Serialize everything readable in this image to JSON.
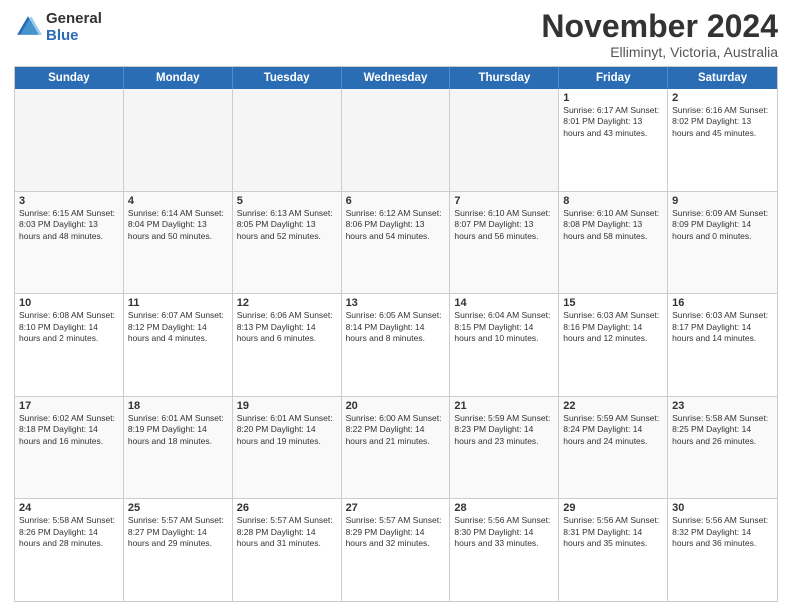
{
  "logo": {
    "line1": "General",
    "line2": "Blue"
  },
  "title": "November 2024",
  "subtitle": "Elliminyt, Victoria, Australia",
  "header_days": [
    "Sunday",
    "Monday",
    "Tuesday",
    "Wednesday",
    "Thursday",
    "Friday",
    "Saturday"
  ],
  "rows": [
    [
      {
        "day": "",
        "text": "",
        "empty": true
      },
      {
        "day": "",
        "text": "",
        "empty": true
      },
      {
        "day": "",
        "text": "",
        "empty": true
      },
      {
        "day": "",
        "text": "",
        "empty": true
      },
      {
        "day": "",
        "text": "",
        "empty": true
      },
      {
        "day": "1",
        "text": "Sunrise: 6:17 AM\nSunset: 8:01 PM\nDaylight: 13 hours\nand 43 minutes.",
        "empty": false
      },
      {
        "day": "2",
        "text": "Sunrise: 6:16 AM\nSunset: 8:02 PM\nDaylight: 13 hours\nand 45 minutes.",
        "empty": false
      }
    ],
    [
      {
        "day": "3",
        "text": "Sunrise: 6:15 AM\nSunset: 8:03 PM\nDaylight: 13 hours\nand 48 minutes.",
        "empty": false
      },
      {
        "day": "4",
        "text": "Sunrise: 6:14 AM\nSunset: 8:04 PM\nDaylight: 13 hours\nand 50 minutes.",
        "empty": false
      },
      {
        "day": "5",
        "text": "Sunrise: 6:13 AM\nSunset: 8:05 PM\nDaylight: 13 hours\nand 52 minutes.",
        "empty": false
      },
      {
        "day": "6",
        "text": "Sunrise: 6:12 AM\nSunset: 8:06 PM\nDaylight: 13 hours\nand 54 minutes.",
        "empty": false
      },
      {
        "day": "7",
        "text": "Sunrise: 6:10 AM\nSunset: 8:07 PM\nDaylight: 13 hours\nand 56 minutes.",
        "empty": false
      },
      {
        "day": "8",
        "text": "Sunrise: 6:10 AM\nSunset: 8:08 PM\nDaylight: 13 hours\nand 58 minutes.",
        "empty": false
      },
      {
        "day": "9",
        "text": "Sunrise: 6:09 AM\nSunset: 8:09 PM\nDaylight: 14 hours\nand 0 minutes.",
        "empty": false
      }
    ],
    [
      {
        "day": "10",
        "text": "Sunrise: 6:08 AM\nSunset: 8:10 PM\nDaylight: 14 hours\nand 2 minutes.",
        "empty": false
      },
      {
        "day": "11",
        "text": "Sunrise: 6:07 AM\nSunset: 8:12 PM\nDaylight: 14 hours\nand 4 minutes.",
        "empty": false
      },
      {
        "day": "12",
        "text": "Sunrise: 6:06 AM\nSunset: 8:13 PM\nDaylight: 14 hours\nand 6 minutes.",
        "empty": false
      },
      {
        "day": "13",
        "text": "Sunrise: 6:05 AM\nSunset: 8:14 PM\nDaylight: 14 hours\nand 8 minutes.",
        "empty": false
      },
      {
        "day": "14",
        "text": "Sunrise: 6:04 AM\nSunset: 8:15 PM\nDaylight: 14 hours\nand 10 minutes.",
        "empty": false
      },
      {
        "day": "15",
        "text": "Sunrise: 6:03 AM\nSunset: 8:16 PM\nDaylight: 14 hours\nand 12 minutes.",
        "empty": false
      },
      {
        "day": "16",
        "text": "Sunrise: 6:03 AM\nSunset: 8:17 PM\nDaylight: 14 hours\nand 14 minutes.",
        "empty": false
      }
    ],
    [
      {
        "day": "17",
        "text": "Sunrise: 6:02 AM\nSunset: 8:18 PM\nDaylight: 14 hours\nand 16 minutes.",
        "empty": false
      },
      {
        "day": "18",
        "text": "Sunrise: 6:01 AM\nSunset: 8:19 PM\nDaylight: 14 hours\nand 18 minutes.",
        "empty": false
      },
      {
        "day": "19",
        "text": "Sunrise: 6:01 AM\nSunset: 8:20 PM\nDaylight: 14 hours\nand 19 minutes.",
        "empty": false
      },
      {
        "day": "20",
        "text": "Sunrise: 6:00 AM\nSunset: 8:22 PM\nDaylight: 14 hours\nand 21 minutes.",
        "empty": false
      },
      {
        "day": "21",
        "text": "Sunrise: 5:59 AM\nSunset: 8:23 PM\nDaylight: 14 hours\nand 23 minutes.",
        "empty": false
      },
      {
        "day": "22",
        "text": "Sunrise: 5:59 AM\nSunset: 8:24 PM\nDaylight: 14 hours\nand 24 minutes.",
        "empty": false
      },
      {
        "day": "23",
        "text": "Sunrise: 5:58 AM\nSunset: 8:25 PM\nDaylight: 14 hours\nand 26 minutes.",
        "empty": false
      }
    ],
    [
      {
        "day": "24",
        "text": "Sunrise: 5:58 AM\nSunset: 8:26 PM\nDaylight: 14 hours\nand 28 minutes.",
        "empty": false
      },
      {
        "day": "25",
        "text": "Sunrise: 5:57 AM\nSunset: 8:27 PM\nDaylight: 14 hours\nand 29 minutes.",
        "empty": false
      },
      {
        "day": "26",
        "text": "Sunrise: 5:57 AM\nSunset: 8:28 PM\nDaylight: 14 hours\nand 31 minutes.",
        "empty": false
      },
      {
        "day": "27",
        "text": "Sunrise: 5:57 AM\nSunset: 8:29 PM\nDaylight: 14 hours\nand 32 minutes.",
        "empty": false
      },
      {
        "day": "28",
        "text": "Sunrise: 5:56 AM\nSunset: 8:30 PM\nDaylight: 14 hours\nand 33 minutes.",
        "empty": false
      },
      {
        "day": "29",
        "text": "Sunrise: 5:56 AM\nSunset: 8:31 PM\nDaylight: 14 hours\nand 35 minutes.",
        "empty": false
      },
      {
        "day": "30",
        "text": "Sunrise: 5:56 AM\nSunset: 8:32 PM\nDaylight: 14 hours\nand 36 minutes.",
        "empty": false
      }
    ]
  ]
}
